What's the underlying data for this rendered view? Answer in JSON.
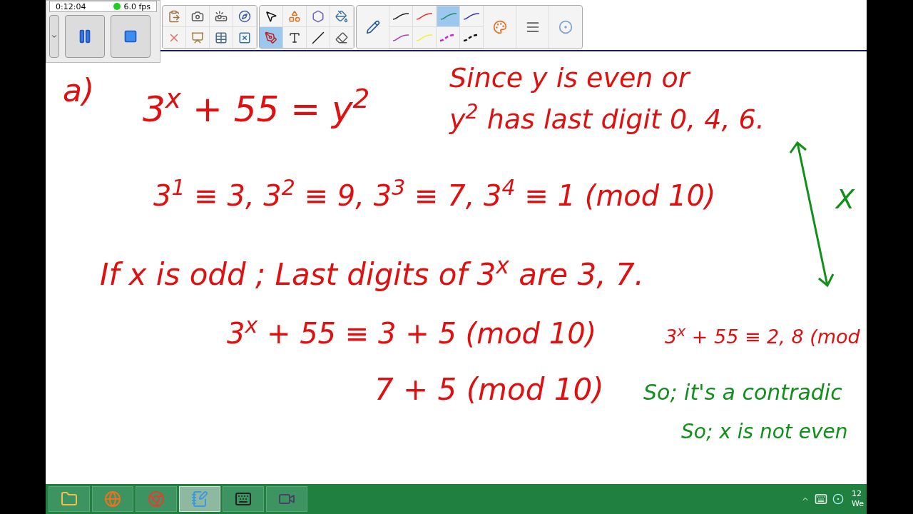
{
  "recorder": {
    "time": "0:12:04",
    "fps": "6.0 fps"
  },
  "toolbar": {
    "groups": [
      {
        "buttons": [
          {
            "kind": "paste",
            "selected": false
          },
          {
            "kind": "camera",
            "selected": false
          },
          {
            "kind": "document-camera",
            "selected": false
          },
          {
            "kind": "compass",
            "selected": false
          },
          {
            "kind": "delete",
            "selected": false
          },
          {
            "kind": "screen",
            "selected": false
          },
          {
            "kind": "table",
            "selected": false
          },
          {
            "kind": "close-box",
            "selected": false
          }
        ]
      },
      {
        "buttons": [
          {
            "kind": "select",
            "selected": false
          },
          {
            "kind": "shapes",
            "selected": false
          },
          {
            "kind": "polygons",
            "selected": false
          },
          {
            "kind": "fill",
            "selected": false
          },
          {
            "kind": "pens",
            "selected": true
          },
          {
            "kind": "text",
            "selected": false
          },
          {
            "kind": "line",
            "selected": false
          },
          {
            "kind": "eraser",
            "selected": false
          }
        ]
      }
    ],
    "pen_styles": [
      {
        "color": "#222222",
        "kind": "solid",
        "selected": false
      },
      {
        "color": "#e03030",
        "kind": "solid",
        "selected": false
      },
      {
        "color": "#20905a",
        "kind": "solid",
        "selected": true
      },
      {
        "color": "#4030c0",
        "kind": "solid",
        "selected": false
      },
      {
        "color": "#b040b0",
        "kind": "solid",
        "selected": false
      },
      {
        "color": "#f0f040",
        "kind": "solid",
        "selected": false
      },
      {
        "color": "#d020d0",
        "kind": "dashed",
        "selected": false
      },
      {
        "color": "#111111",
        "kind": "dashed",
        "selected": false
      }
    ]
  },
  "ink": [
    {
      "text": "a)",
      "color": "#e01010"
    },
    {
      "text": "3$^{x}$ + 55 = y$^{2}$",
      "color": "#e01010"
    },
    {
      "text": "Since y is even or",
      "color": "#e01010"
    },
    {
      "text": "y$^{2}$ has last digit  0, 4, 6.",
      "color": "#e01010"
    },
    {
      "text": "3$^{1}$ ≡ 3,  3$^{2}$ ≡ 9,  3$^{3}$ ≡ 7,  3$^{4}$ ≡ 1  (mod 10)",
      "color": "#e01010"
    },
    {
      "text": "X",
      "color": "#10901a"
    },
    {
      "text": "If  x is odd ; Last digits of 3$^{x}$ are 3, 7.",
      "color": "#e01010"
    },
    {
      "text": "3$^{x}$ + 55 ≡ 3 + 5  (mod 10)",
      "color": "#e01010"
    },
    {
      "text": "3$^{x}$ + 55 ≡ 2, 8 (mod",
      "color": "#e01010"
    },
    {
      "text": "7 + 5  (mod 10)",
      "color": "#e01010"
    },
    {
      "text": "So; it's a contradic",
      "color": "#10901a"
    },
    {
      "text": "So;  x is not even",
      "color": "#10901a"
    }
  ],
  "taskbar": {
    "apps": [
      {
        "kind": "folder",
        "selected": false
      },
      {
        "kind": "firefox",
        "selected": false
      },
      {
        "kind": "chrome",
        "selected": false
      },
      {
        "kind": "notebook",
        "selected": true
      },
      {
        "kind": "keyboard",
        "selected": false
      },
      {
        "kind": "recorder",
        "selected": false
      }
    ],
    "clock_time": "12",
    "clock_day": "We"
  }
}
